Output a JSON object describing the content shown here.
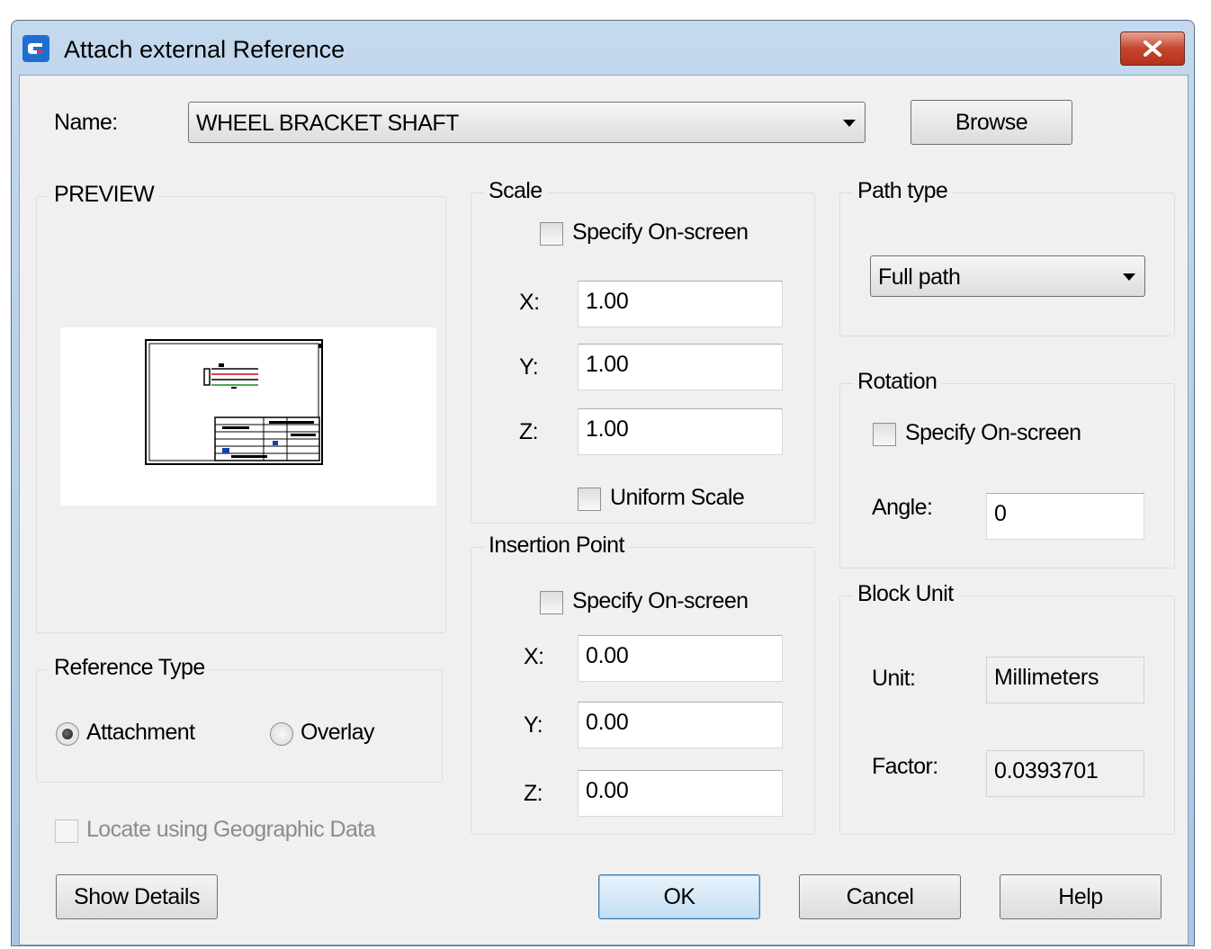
{
  "window": {
    "title": "Attach external Reference"
  },
  "name_row": {
    "label": "Name:",
    "value": "WHEEL BRACKET SHAFT",
    "browse_label": "Browse"
  },
  "preview": {
    "title": "PREVIEW"
  },
  "scale": {
    "title": "Scale",
    "specify_label": "Specify On-screen",
    "x_label": "X:",
    "y_label": "Y:",
    "z_label": "Z:",
    "x_value": "1.00",
    "y_value": "1.00",
    "z_value": "1.00",
    "uniform_label": "Uniform Scale"
  },
  "insertion": {
    "title": "Insertion Point",
    "specify_label": "Specify On-screen",
    "x_label": "X:",
    "y_label": "Y:",
    "z_label": "Z:",
    "x_value": "0.00",
    "y_value": "0.00",
    "z_value": "0.00"
  },
  "path_type": {
    "title": "Path type",
    "selected": "Full path"
  },
  "rotation": {
    "title": "Rotation",
    "specify_label": "Specify On-screen",
    "angle_label": "Angle:",
    "angle_value": "0"
  },
  "block_unit": {
    "title": "Block Unit",
    "unit_label": "Unit:",
    "unit_value": "Millimeters",
    "factor_label": "Factor:",
    "factor_value": "0.0393701"
  },
  "reference_type": {
    "title": "Reference Type",
    "attachment_label": "Attachment",
    "overlay_label": "Overlay",
    "selected": "Attachment"
  },
  "geo": {
    "label": "Locate using Geographic Data"
  },
  "buttons": {
    "show_details": "Show Details",
    "ok": "OK",
    "cancel": "Cancel",
    "help": "Help"
  },
  "colors": {
    "title_gradient_top": "#c4d9ee",
    "close_button": "#c6452f",
    "dialog_bg": "#f0f0f0",
    "default_button": "#c2def3"
  },
  "icons": [
    "app-logo-icon",
    "close-icon",
    "dropdown-arrow-icon",
    "radio-dot-icon",
    "drawing-thumbnail"
  ]
}
